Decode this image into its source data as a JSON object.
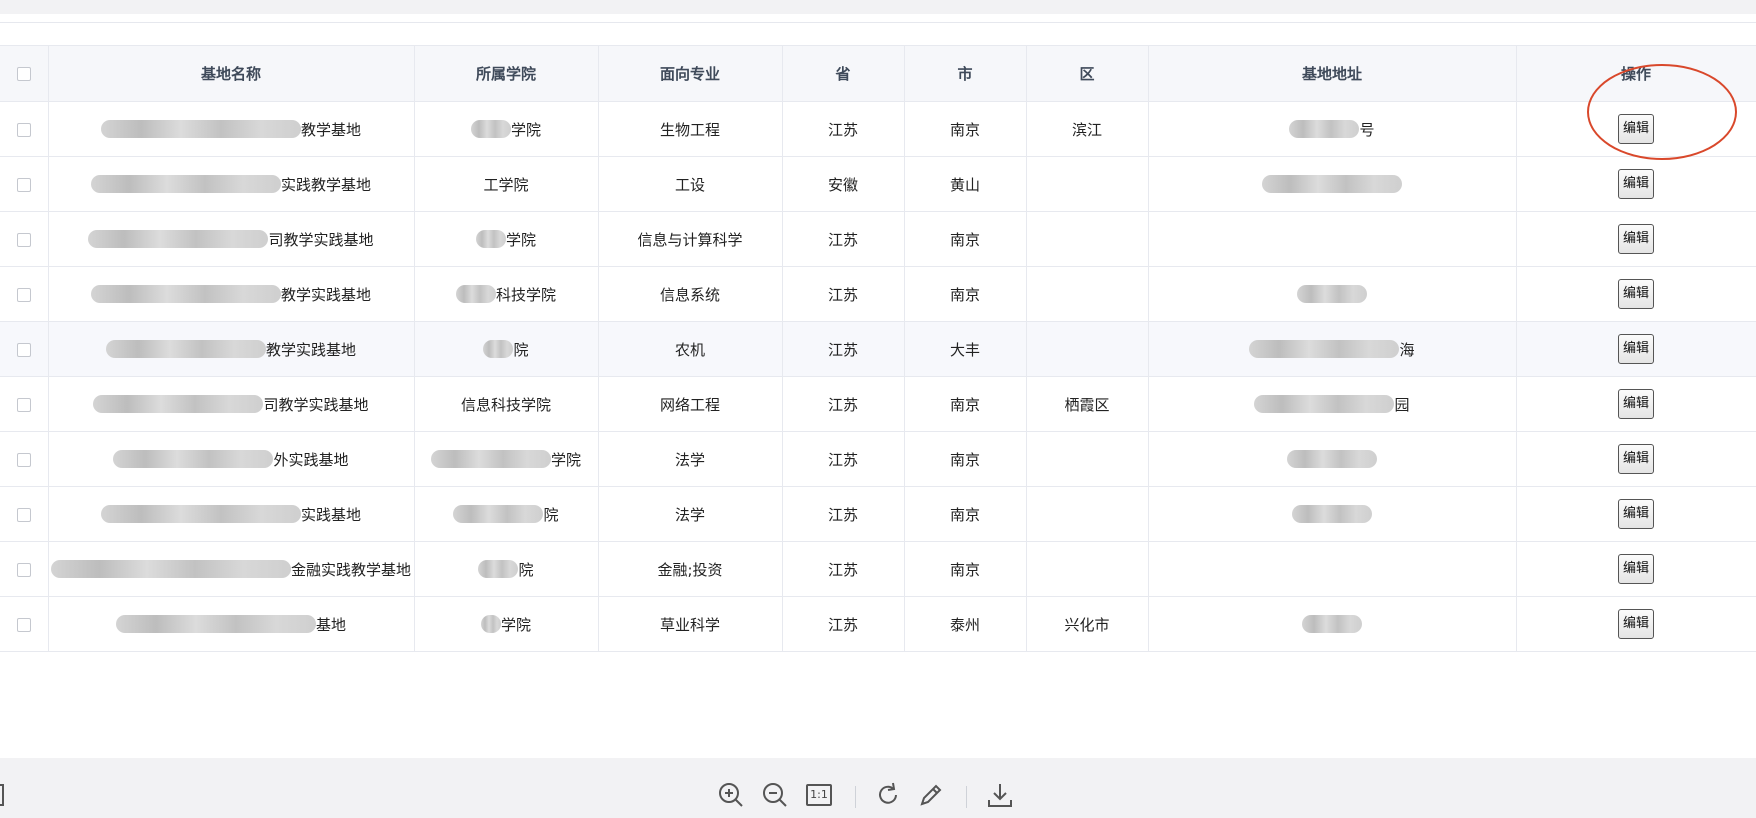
{
  "table": {
    "columns": [
      "基地名称",
      "所属学院",
      "面向专业",
      "省",
      "市",
      "区",
      "基地地址",
      "操作"
    ],
    "rows": [
      {
        "name": "教学基地",
        "college": "学院",
        "major": "生物工程",
        "province": "江苏",
        "city": "南京",
        "district": "滨江",
        "address": "号",
        "action": "编辑"
      },
      {
        "name": "实践教学基地",
        "college": "工学院",
        "major": "工设",
        "province": "安徽",
        "city": "黄山",
        "district": "",
        "address": "",
        "action": "编辑"
      },
      {
        "name": "司教学实践基地",
        "college": "学院",
        "major": "信息与计算科学",
        "province": "江苏",
        "city": "南京",
        "district": "",
        "address": "",
        "action": "编辑"
      },
      {
        "name": "教学实践基地",
        "college": "科技学院",
        "major": "信息系统",
        "province": "江苏",
        "city": "南京",
        "district": "",
        "address": "",
        "action": "编辑"
      },
      {
        "name": "教学实践基地",
        "college": "院",
        "major": "农机",
        "province": "江苏",
        "city": "大丰",
        "district": "",
        "address": "海",
        "action": "编辑"
      },
      {
        "name": "司教学实践基地",
        "college": "信息科技学院",
        "major": "网络工程",
        "province": "江苏",
        "city": "南京",
        "district": "栖霞区",
        "address": "园",
        "action": "编辑"
      },
      {
        "name": "外实践基地",
        "college": "学院",
        "major": "法学",
        "province": "江苏",
        "city": "南京",
        "district": "",
        "address": "",
        "action": "编辑"
      },
      {
        "name": "实践基地",
        "college": "院",
        "major": "法学",
        "province": "江苏",
        "city": "南京",
        "district": "",
        "address": "",
        "action": "编辑"
      },
      {
        "name": "金融实践教学基地",
        "college": "院",
        "major": "金融;投资",
        "province": "江苏",
        "city": "南京",
        "district": "",
        "address": "",
        "action": "编辑"
      },
      {
        "name": "基地",
        "college": "学院",
        "major": "草业科学",
        "province": "江苏",
        "city": "泰州",
        "district": "兴化市",
        "address": "",
        "action": "编辑"
      }
    ]
  },
  "toolbar": {
    "icons": [
      "zoom-in-icon",
      "zoom-out-icon",
      "actual-size-icon",
      "rotate-icon",
      "pencil-icon",
      "download-icon"
    ],
    "actual_size_label": "1:1"
  },
  "colors": {
    "annotation": "#d9482b",
    "header_bg": "#f6f7fa"
  }
}
